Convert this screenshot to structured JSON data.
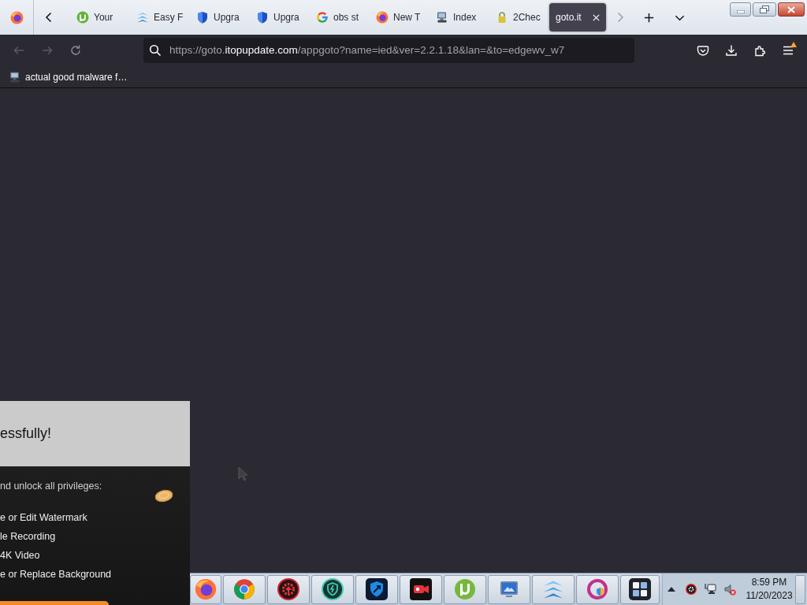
{
  "browser": {
    "tabs": [
      {
        "label": "Your",
        "kind": "mu_logo",
        "selected": false
      },
      {
        "label": "Easy F",
        "kind": "chevron_stack",
        "selected": false
      },
      {
        "label": "Upgra",
        "kind": "shield",
        "selected": false
      },
      {
        "label": "Upgra",
        "kind": "shield",
        "selected": false
      },
      {
        "label": "obs st",
        "kind": "google",
        "selected": false
      },
      {
        "label": "New T",
        "kind": "firefox",
        "selected": false
      },
      {
        "label": "Index",
        "kind": "computer",
        "selected": false
      },
      {
        "label": "2Chec",
        "kind": "lock",
        "selected": false
      },
      {
        "label": "goto.it",
        "selected": true
      }
    ],
    "nav_buttons": [
      {
        "kind": "back",
        "disabled": true
      },
      {
        "kind": "forward",
        "disabled": true
      },
      {
        "kind": "reload",
        "disabled": false
      }
    ],
    "address_bar": {
      "url_parts": [
        {
          "text": "https://goto.",
          "highlight": false
        },
        {
          "text": "itopupdate.com",
          "highlight": true
        },
        {
          "text": "/appgoto?name=ied&ver=2.2.1.18&lan=&to=edgewv_w7",
          "highlight": false
        }
      ]
    },
    "menu_button": {
      "update_badge": true
    },
    "bookmarks": [
      {
        "label": "actual good malware f…"
      }
    ]
  },
  "popup": {
    "title": "essfully!",
    "intro": "nd unlock all privileges:",
    "features": [
      "e or Edit Watermark",
      "le Recording",
      "4K Video",
      "e or Replace Background"
    ]
  },
  "taskbar": {
    "volume_muted": true,
    "clock": {
      "time": "8:59 PM",
      "date": "11/20/2023"
    }
  }
}
